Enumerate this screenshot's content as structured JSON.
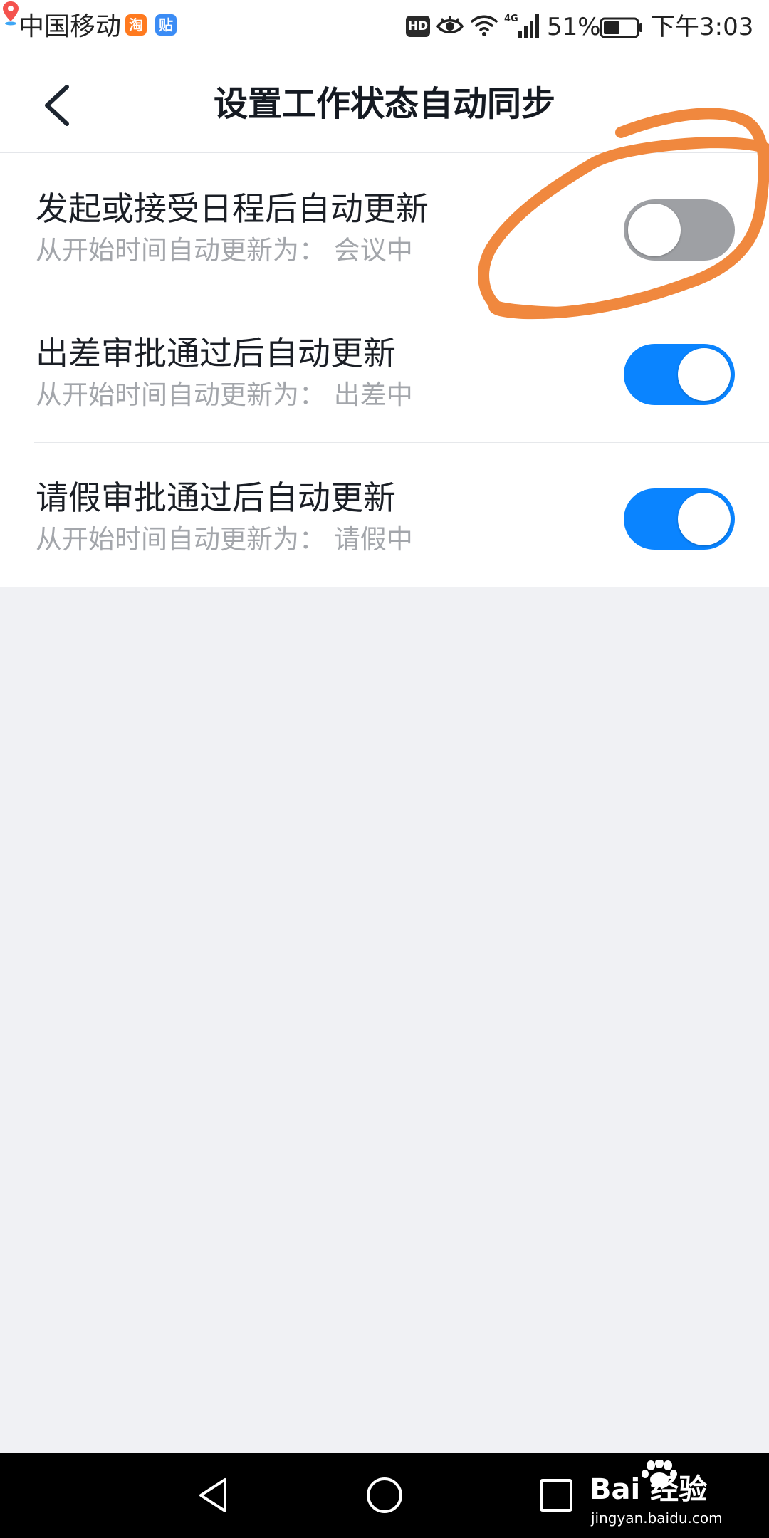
{
  "status_bar": {
    "carrier": "中国移动",
    "notification_icons": [
      "taobao-icon",
      "tieba-icon",
      "map-pin-icon"
    ],
    "taobao_glyph": "淘",
    "tieba_glyph": "贴",
    "hd_label": "HD",
    "network_label": "4G",
    "battery_percent": "51%",
    "battery_level": 0.51,
    "time": "下午3:03"
  },
  "header": {
    "back_icon": "chevron-left-icon",
    "title": "设置工作状态自动同步"
  },
  "settings": [
    {
      "title": "发起或接受日程后自动更新",
      "description": "从开始时间自动更新为：  会议中",
      "enabled": false
    },
    {
      "title": "出差审批通过后自动更新",
      "description": "从开始时间自动更新为：  出差中",
      "enabled": true
    },
    {
      "title": "请假审批通过后自动更新",
      "description": "从开始时间自动更新为：  请假中",
      "enabled": true
    }
  ],
  "colors": {
    "toggle_on": "#0a84ff",
    "toggle_off": "#9ea0a4",
    "annotation": "#f0883e",
    "page_background": "#f0f1f4"
  },
  "nav_bar": {
    "icons": [
      "triangle-back-icon",
      "circle-home-icon",
      "square-recents-icon"
    ]
  },
  "watermark": {
    "brand": "Bai 经验",
    "url": "jingyan.baidu.com"
  }
}
